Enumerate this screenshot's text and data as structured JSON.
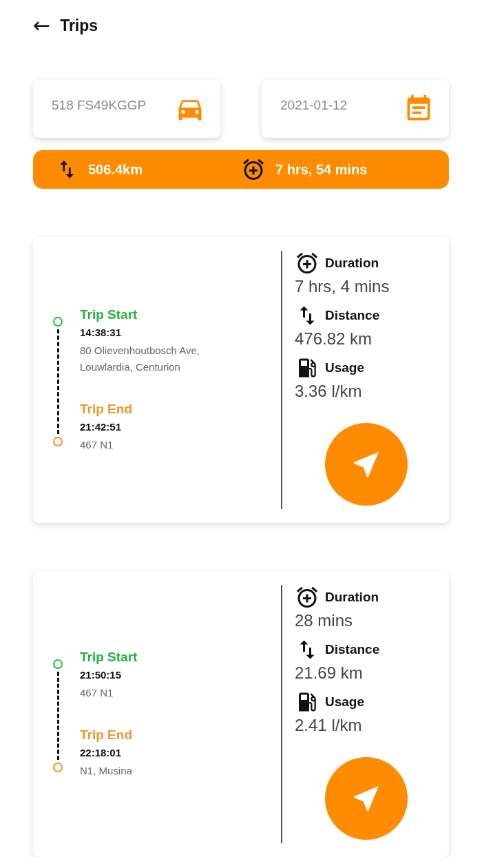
{
  "header": {
    "back_icon": "←",
    "title": "Trips"
  },
  "filters": [
    {
      "kind": "vehicle",
      "value": "518 FS49KGGP"
    },
    {
      "kind": "date",
      "value": "2021-01-12"
    }
  ],
  "summary": {
    "distance": "506.4km",
    "duration": "7 hrs, 54 mins"
  },
  "trips": [
    {
      "start": {
        "label": "Trip Start",
        "time": "14:38:31",
        "address": "80 Olievenhoutbosch Ave, Louwlardia, Centurion"
      },
      "end": {
        "label": "Trip End",
        "time": "21:42:51",
        "address": "467 N1"
      },
      "stats": [
        {
          "kind": "duration",
          "label": "Duration",
          "value": "7 hrs, 4 mins"
        },
        {
          "kind": "distance",
          "label": "Distance",
          "value": "476.82 km"
        },
        {
          "kind": "usage",
          "label": "Usage",
          "value": "3.36 l/km"
        }
      ]
    },
    {
      "start": {
        "label": "Trip Start",
        "time": "21:50:15",
        "address": "467 N1"
      },
      "end": {
        "label": "Trip End",
        "time": "22:18:01",
        "address": "N1, Musina"
      },
      "stats": [
        {
          "kind": "duration",
          "label": "Duration",
          "value": "28 mins"
        },
        {
          "kind": "distance",
          "label": "Distance",
          "value": "21.69 km"
        },
        {
          "kind": "usage",
          "label": "Usage",
          "value": "2.41 l/km"
        }
      ]
    }
  ]
}
